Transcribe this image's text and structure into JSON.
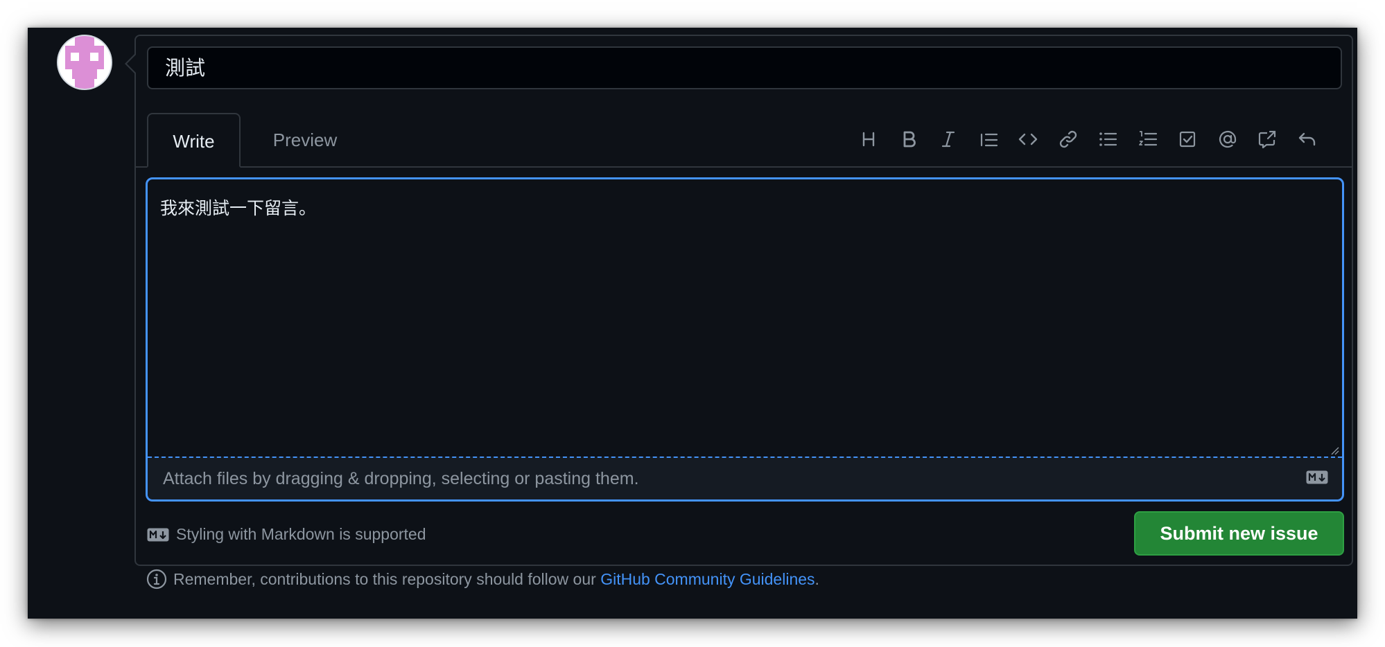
{
  "issue": {
    "title_value": "測試",
    "body_value": "我來測試一下留言。"
  },
  "tabs": [
    {
      "label": "Write",
      "active": true
    },
    {
      "label": "Preview",
      "active": false
    }
  ],
  "toolbar": {
    "icons": [
      "heading-icon",
      "bold-icon",
      "italic-icon",
      "quote-icon",
      "code-icon",
      "link-icon",
      "unordered-list-icon",
      "ordered-list-icon",
      "tasklist-icon",
      "mention-icon",
      "cross-reference-icon",
      "undo-icon"
    ]
  },
  "attach": {
    "text": "Attach files by dragging & dropping, selecting or pasting them."
  },
  "footer": {
    "markdown_support": "Styling with Markdown is supported",
    "submit_label": "Submit new issue",
    "guidelines_prefix": "Remember, contributions to this repository should follow our ",
    "guidelines_link": "GitHub Community Guidelines",
    "guidelines_suffix": "."
  },
  "colors": {
    "background": "#0d1117",
    "focus_border": "#4493f8",
    "submit_button": "#238636",
    "link": "#4493f8",
    "avatar_accent": "#dc8fd6"
  }
}
